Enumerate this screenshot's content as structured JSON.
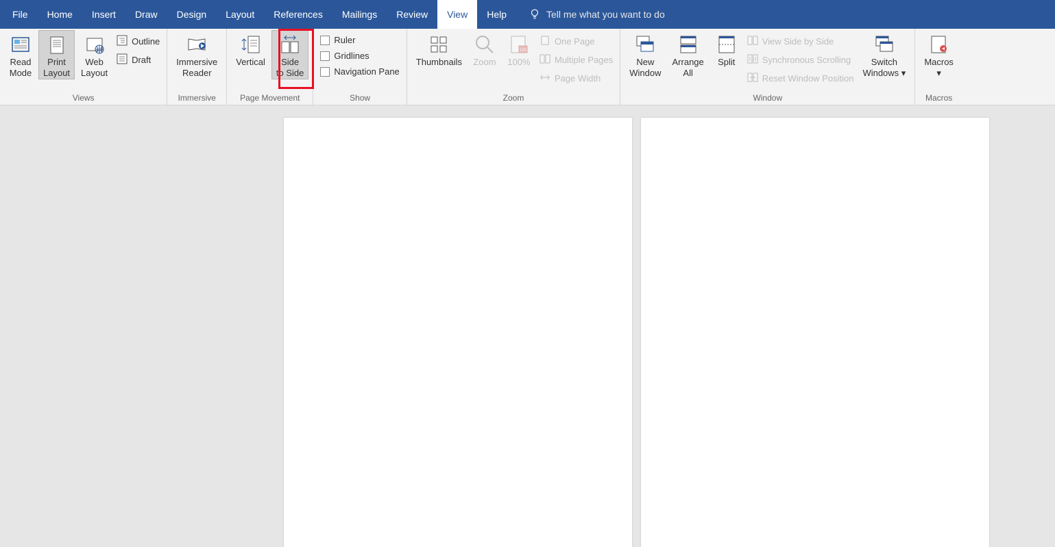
{
  "menu": {
    "tabs": [
      "File",
      "Home",
      "Insert",
      "Draw",
      "Design",
      "Layout",
      "References",
      "Mailings",
      "Review",
      "View",
      "Help"
    ],
    "active": "View",
    "tell_me": "Tell me what you want to do"
  },
  "ribbon": {
    "views": {
      "label": "Views",
      "read_mode": "Read Mode",
      "print_layout": "Print Layout",
      "web_layout": "Web Layout",
      "outline": "Outline",
      "draft": "Draft"
    },
    "immersive": {
      "label": "Immersive",
      "immersive_reader": "Immersive Reader"
    },
    "page_movement": {
      "label": "Page Movement",
      "vertical": "Vertical",
      "side_to_side": "Side to Side"
    },
    "show": {
      "label": "Show",
      "ruler": "Ruler",
      "gridlines": "Gridlines",
      "navigation_pane": "Navigation Pane"
    },
    "zoom": {
      "label": "Zoom",
      "thumbnails": "Thumbnails",
      "zoom": "Zoom",
      "hundred": "100%",
      "one_page": "One Page",
      "multiple_pages": "Multiple Pages",
      "page_width": "Page Width"
    },
    "window": {
      "label": "Window",
      "new_window": "New Window",
      "arrange_all": "Arrange All",
      "split": "Split",
      "view_side_by_side": "View Side by Side",
      "sync_scroll": "Synchronous Scrolling",
      "reset_pos": "Reset Window Position",
      "switch_windows": "Switch Windows"
    },
    "macros": {
      "label": "Macros",
      "macros": "Macros"
    }
  }
}
